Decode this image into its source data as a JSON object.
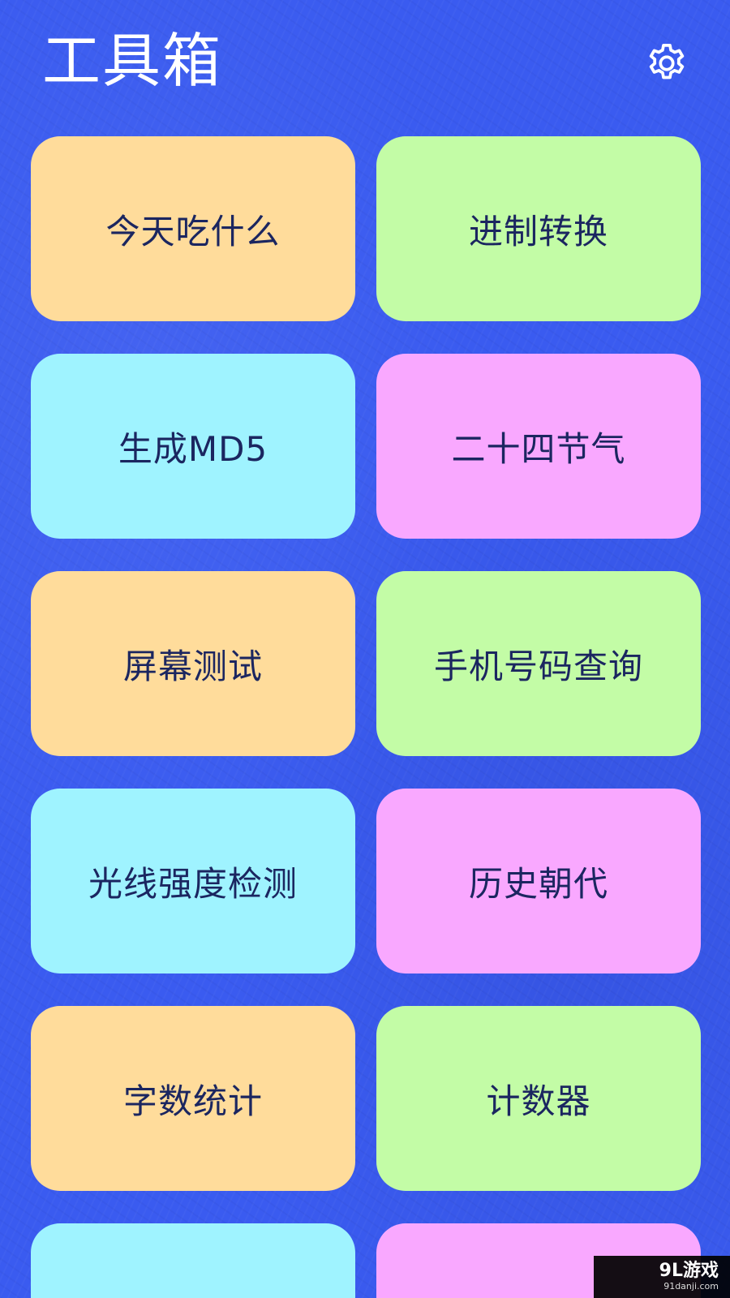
{
  "header": {
    "title": "工具箱",
    "settings_icon": "gear-icon"
  },
  "tools": [
    {
      "label": "今天吃什么",
      "color": "#ffdc9b"
    },
    {
      "label": "进制转换",
      "color": "#c3fca6"
    },
    {
      "label": "生成MD5",
      "color": "#9ff3ff"
    },
    {
      "label": "二十四节气",
      "color": "#f9a8ff"
    },
    {
      "label": "屏幕测试",
      "color": "#ffdc9b"
    },
    {
      "label": "手机号码查询",
      "color": "#c3fca6"
    },
    {
      "label": "光线强度检测",
      "color": "#9ff3ff"
    },
    {
      "label": "历史朝代",
      "color": "#f9a8ff"
    },
    {
      "label": "字数统计",
      "color": "#ffdc9b"
    },
    {
      "label": "计数器",
      "color": "#c3fca6"
    },
    {
      "label": "",
      "color": "#9ff3ff"
    },
    {
      "label": "",
      "color": "#f9a8ff"
    }
  ],
  "theme": {
    "background": "#3a5bf0",
    "text": "#1b2660"
  },
  "watermark": {
    "main": "9L游戏",
    "sub": "91danji.com"
  }
}
